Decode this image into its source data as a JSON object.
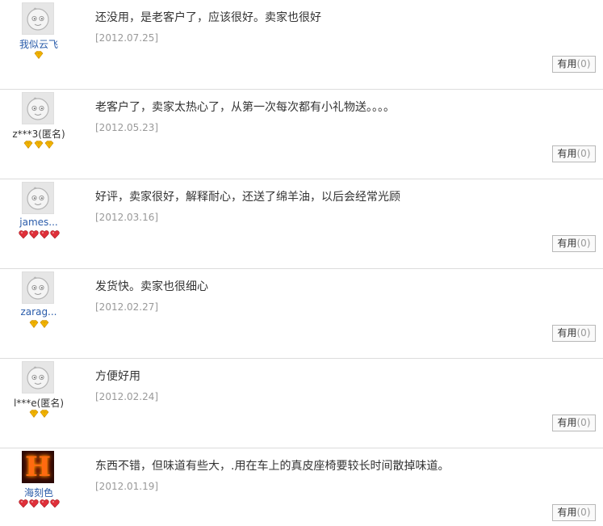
{
  "reviews": [
    {
      "username": "我似云飞",
      "anonymous": false,
      "avatar": "default-face-avatar",
      "badge_type": "yellow-diamond",
      "badge_count": 1,
      "content": "还没用，是老客户了，应该很好。卖家也很好",
      "date": "[2012.07.25]",
      "useful_label": "有用",
      "useful_count": "(0)"
    },
    {
      "username": "z***3(匿名)",
      "anonymous": true,
      "avatar": "default-face-avatar",
      "badge_type": "yellow-diamond",
      "badge_count": 3,
      "content": "老客户了，卖家太热心了，从第一次每次都有小礼物送。。。。",
      "date": "[2012.05.23]",
      "useful_label": "有用",
      "useful_count": "(0)"
    },
    {
      "username": "james...",
      "anonymous": false,
      "avatar": "default-face-avatar",
      "badge_type": "red-heart",
      "badge_count": 4,
      "content": "好评，卖家很好，解释耐心，还送了绵羊油，以后会经常光顾",
      "date": "[2012.03.16]",
      "useful_label": "有用",
      "useful_count": "(0)"
    },
    {
      "username": "zarag...",
      "anonymous": false,
      "avatar": "default-face-avatar",
      "badge_type": "yellow-diamond",
      "badge_count": 2,
      "content": "发货快。卖家也很细心",
      "date": "[2012.02.27]",
      "useful_label": "有用",
      "useful_count": "(0)"
    },
    {
      "username": "l***e(匿名)",
      "anonymous": true,
      "avatar": "default-face-avatar",
      "badge_type": "yellow-diamond",
      "badge_count": 2,
      "content": "方便好用",
      "date": "[2012.02.24]",
      "useful_label": "有用",
      "useful_count": "(0)"
    },
    {
      "username": "海刻色",
      "anonymous": false,
      "avatar": "flaming-h-avatar",
      "avatar_letter": "H",
      "badge_type": "red-heart",
      "badge_count": 4,
      "content": "东西不错，但味道有些大，.用在车上的真皮座椅要较长时间散掉味道。",
      "date": "[2012.01.19]",
      "useful_label": "有用",
      "useful_count": "(0)"
    }
  ],
  "colors": {
    "username_link": "#2a5caa",
    "date": "#999999",
    "separator": "#dcdcdc",
    "yellow_diamond": "#f5b800",
    "red_heart": "#e0303a"
  }
}
